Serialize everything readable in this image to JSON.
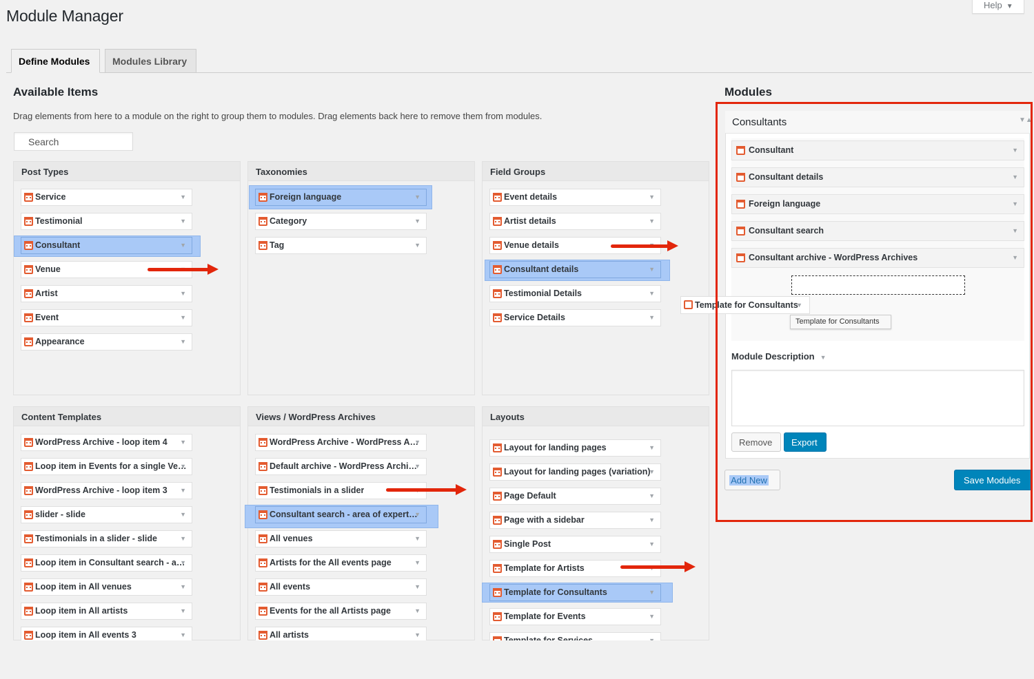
{
  "page": {
    "title": "Module Manager",
    "help": "Help"
  },
  "tabs": [
    {
      "label": "Define Modules"
    },
    {
      "label": "Modules Library"
    }
  ],
  "available": {
    "heading": "Available Items",
    "description": "Drag elements from here to a module on the right to group them to modules. Drag elements back here to remove them from modules.",
    "search_placeholder": "Search"
  },
  "panels": {
    "post_types": {
      "title": "Post Types",
      "items": [
        "Service",
        "Testimonial",
        "Consultant",
        "Venue",
        "Artist",
        "Event",
        "Appearance"
      ]
    },
    "taxonomies": {
      "title": "Taxonomies",
      "items": [
        "Foreign language",
        "Category",
        "Tag"
      ]
    },
    "field_groups": {
      "title": "Field Groups",
      "items": [
        "Event details",
        "Artist details",
        "Venue details",
        "Consultant details",
        "Testimonial Details",
        "Service Details"
      ]
    },
    "content_templates": {
      "title": "Content Templates",
      "items": [
        "WordPress Archive - loop item 4",
        "Loop item in Events for a single Ve…",
        "WordPress Archive - loop item 3",
        "slider - slide",
        "Testimonials in a slider - slide",
        "Loop item in Consultant search - a…",
        "Loop item in All venues",
        "Loop item in All artists",
        "Loop item in All events 3"
      ]
    },
    "views": {
      "title": "Views / WordPress Archives",
      "items": [
        "WordPress Archive - WordPress A…",
        "Default archive - WordPress Archi…",
        "Testimonials in a slider",
        "Consultant search - area of expert…",
        "All venues",
        "Artists for the All events page",
        "All events",
        "Events for the all Artists page",
        "All artists"
      ]
    },
    "layouts": {
      "title": "Layouts",
      "items": [
        "Layout for landing pages",
        "Layout for landing pages (variation)",
        "Page Default",
        "Page with a sidebar",
        "Single Post",
        "Template for Artists",
        "Template for Consultants",
        "Template for Events",
        "Template for Services"
      ]
    }
  },
  "modules": {
    "heading": "Modules",
    "module_name": "Consultants",
    "items": [
      "Consultant",
      "Consultant details",
      "Foreign language",
      "Consultant search",
      "Consultant archive - WordPress Archives"
    ],
    "dragging_item": "Template for Consultants",
    "tooltip": "Template for Consultants",
    "description_label": "Module Description",
    "remove": "Remove",
    "export": "Export",
    "add_new": "Add New",
    "save": "Save Modules"
  },
  "colors": {
    "accent": "#0085ba",
    "highlight": "#a9c9f7",
    "annotation": "#e2260b",
    "icon": "#e35b30"
  }
}
